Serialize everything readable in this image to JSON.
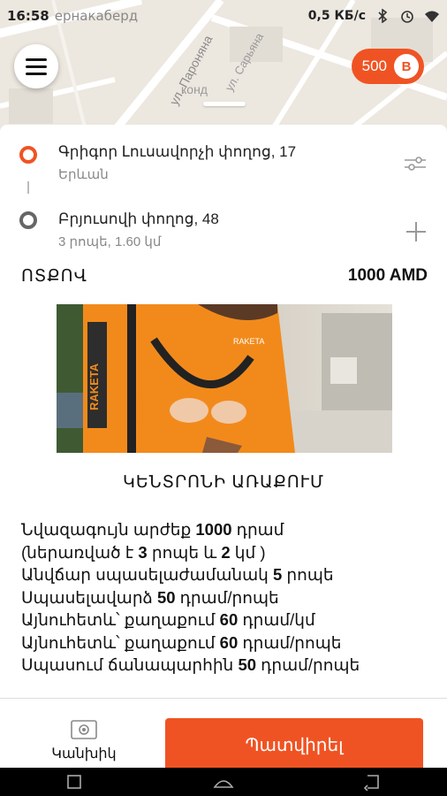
{
  "status_bar": {
    "time": "16:58",
    "location": "ернакаберд",
    "network_speed": "0,5 КБ/с"
  },
  "map": {
    "street_labels": [
      "ул. Пароняна",
      "конд",
      "ул. Сарьяна"
    ]
  },
  "balance": {
    "amount": "500",
    "currency_symbol": "B"
  },
  "route": {
    "from": {
      "title": "Գրիգոր Լուսավորչի փողոց, 17",
      "subtitle": "Երևան"
    },
    "to": {
      "title": "Բրյուսովի փողոց, 48",
      "subtitle": "3 րոպե, 1.60 կմ"
    }
  },
  "tariff": {
    "name": "ՈՏՔՈՎ",
    "price": "1000 AMD"
  },
  "promo": {
    "heading": "ԿԵՆՏՐՈՆԻ ԱՌԱՔՈՒՄ",
    "image_text": "RAKETA"
  },
  "description": {
    "line1_pre": "Նվազագույն արժեք ",
    "line1_bold": "1000",
    "line1_post": " դրամ",
    "line2_pre": "(ներառված է ",
    "line2_bold1": "3",
    "line2_mid": " րոպե և ",
    "line2_bold2": "2",
    "line2_post": " կմ )",
    "line3_pre": "Անվճար սպասելաժամանակ ",
    "line3_bold": "5",
    "line3_post": " րոպե",
    "line4_pre": "Սպասելավարձ ",
    "line4_bold": "50",
    "line4_post": " դրամ/րոպե",
    "line5_pre": "Այնուհետև՝ քաղաքում  ",
    "line5_bold": "60",
    "line5_post": " դրամ/կմ",
    "line6_pre": "Այնուհետև՝ քաղաքում ",
    "line6_bold": "60",
    "line6_post": " դրամ/րոպե",
    "line7_pre": "Սպասում ճանապարհին ",
    "line7_bold": "50",
    "line7_post": " դրամ/րոպե"
  },
  "payment": {
    "method_label": "Կանխիկ",
    "icon": "cash-icon"
  },
  "order_button": {
    "label": "Պատվիրել"
  },
  "colors": {
    "accent": "#f05323"
  }
}
